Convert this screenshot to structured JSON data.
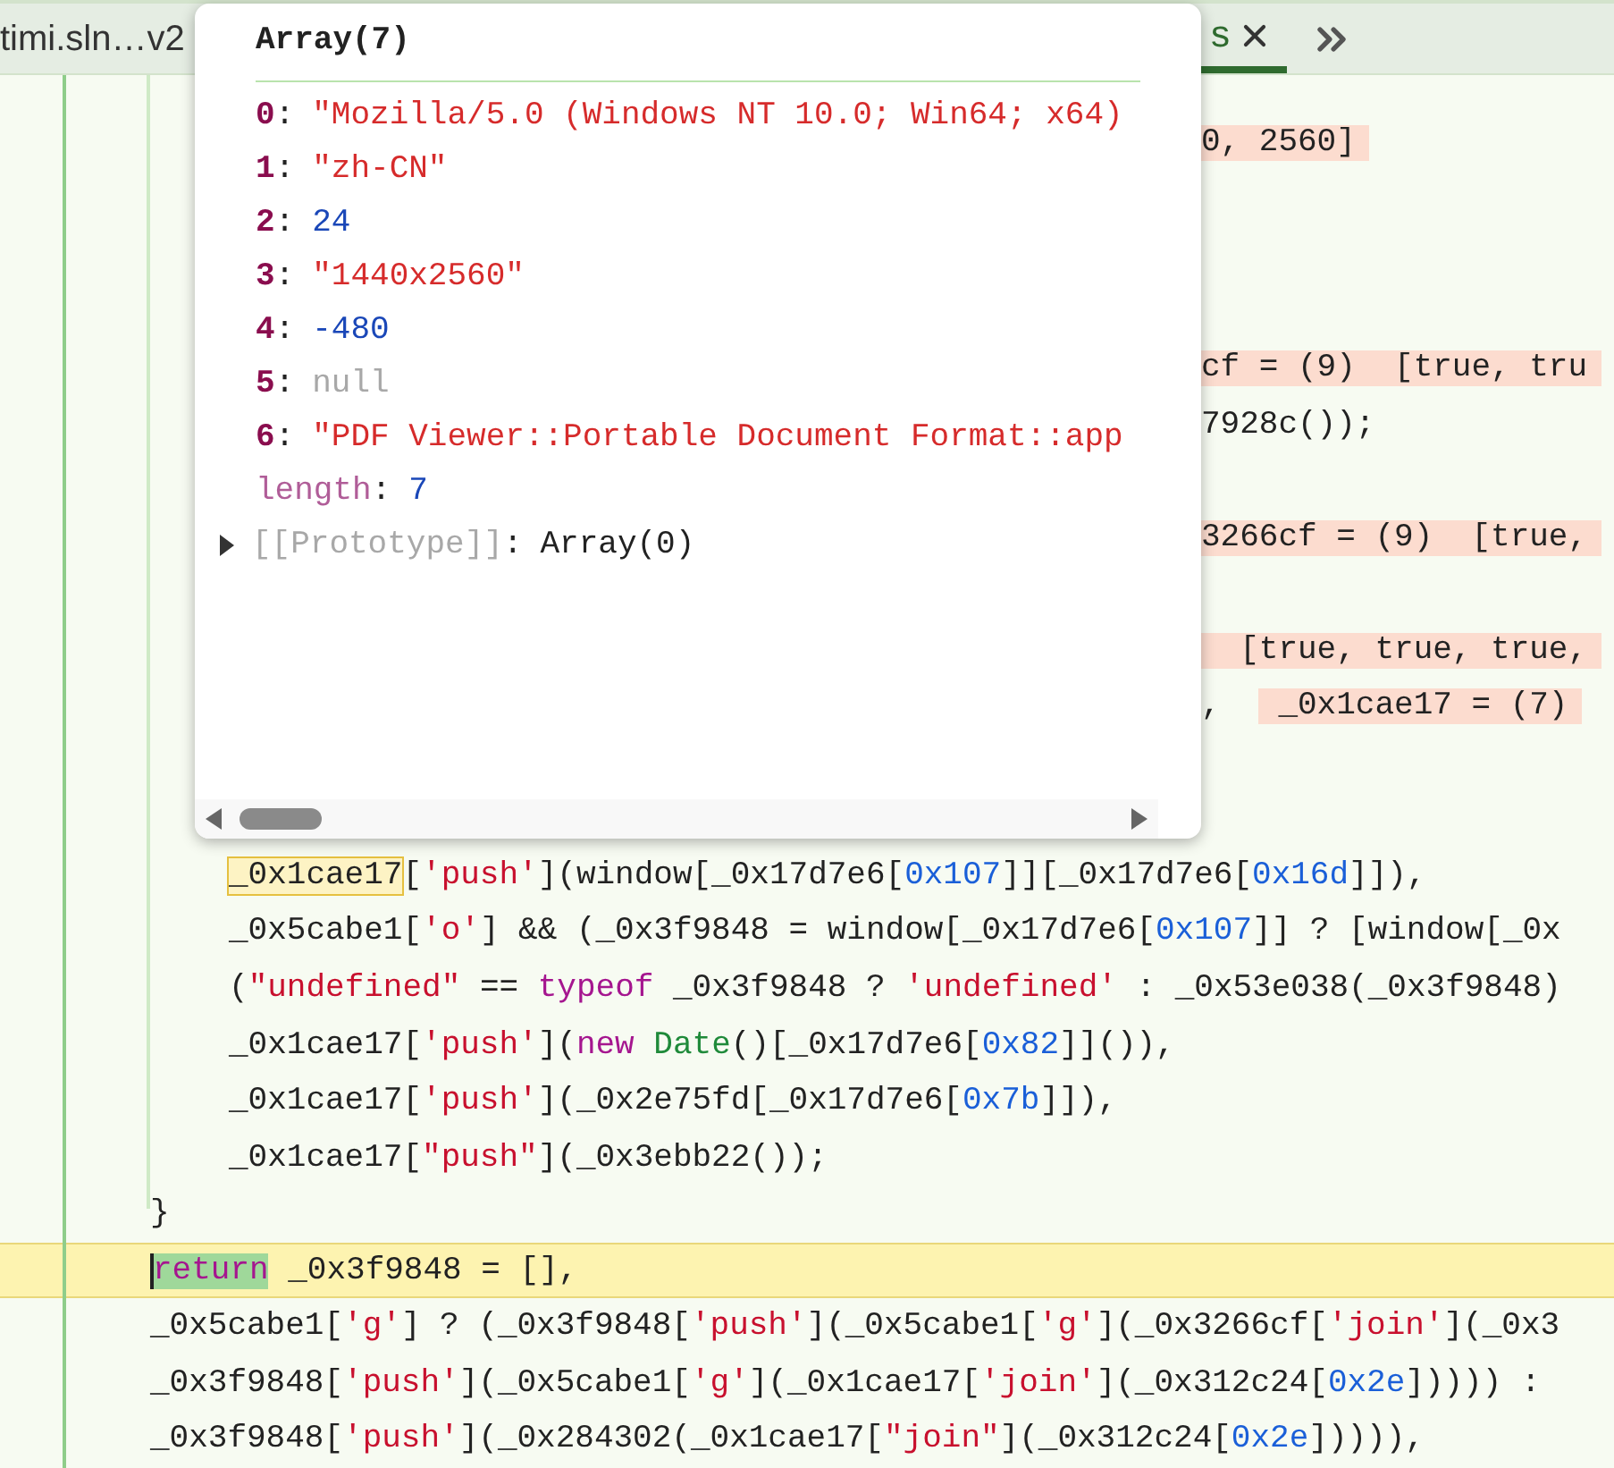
{
  "tabs": [
    {
      "label": "timi.sln…v2",
      "selected": false,
      "closable": false
    },
    {
      "label": "s",
      "selected": true,
      "closable": true
    }
  ],
  "popup": {
    "title": "Array(7)",
    "entries": [
      {
        "kind": "index",
        "key": "0",
        "separator": ":",
        "value": {
          "kind": "string",
          "text": "\"Mozilla/5.0 (Windows NT 10.0; Win64; x64)"
        }
      },
      {
        "kind": "index",
        "key": "1",
        "separator": ":",
        "value": {
          "kind": "string",
          "text": "\"zh-CN\""
        }
      },
      {
        "kind": "index",
        "key": "2",
        "separator": ":",
        "value": {
          "kind": "number",
          "text": "24"
        }
      },
      {
        "kind": "index",
        "key": "3",
        "separator": ":",
        "value": {
          "kind": "string",
          "text": "\"1440x2560\""
        }
      },
      {
        "kind": "index",
        "key": "4",
        "separator": ":",
        "value": {
          "kind": "number",
          "text": "-480"
        }
      },
      {
        "kind": "index",
        "key": "5",
        "separator": ":",
        "value": {
          "kind": "null",
          "text": "null"
        }
      },
      {
        "kind": "index",
        "key": "6",
        "separator": ":",
        "value": {
          "kind": "string",
          "text": "\"PDF Viewer::Portable Document Format::app"
        }
      },
      {
        "kind": "property",
        "key": "length",
        "separator": ":",
        "value": {
          "kind": "number",
          "text": "7"
        }
      },
      {
        "kind": "internal",
        "key": "[[Prototype]]",
        "separator": ":",
        "value": {
          "kind": "plain",
          "text": "Array(0)"
        },
        "expanded": false
      }
    ]
  },
  "editor": {
    "lines": [
      {
        "kind": "fragment",
        "segments": [
          {
            "text": "0, 2560]",
            "highlight": true
          }
        ]
      },
      {
        "kind": "blank"
      },
      {
        "kind": "blank"
      },
      {
        "kind": "blank"
      },
      {
        "kind": "fragment",
        "segments": [
          {
            "text": "cf = (9)  [true, tru",
            "highlight": true
          }
        ]
      },
      {
        "kind": "fragment",
        "segments": [
          {
            "text": "7928c());",
            "highlight": false
          }
        ]
      },
      {
        "kind": "blank"
      },
      {
        "kind": "fragment",
        "segments": [
          {
            "text": "3266cf = (9)  [true,",
            "highlight": true
          }
        ]
      },
      {
        "kind": "blank"
      },
      {
        "kind": "fragment",
        "segments": [
          {
            "text": "  [true, true, true,",
            "highlight": true
          }
        ]
      },
      {
        "kind": "fragment",
        "segments": [
          {
            "text": ",  ",
            "highlight": false
          },
          {
            "text": " _0x1cae17 = (7)",
            "highlight": true
          }
        ]
      },
      {
        "kind": "blank"
      },
      {
        "kind": "blank"
      },
      {
        "kind": "block",
        "children": [
          {
            "kind": "code",
            "current": false,
            "tokens": [
              {
                "kind": "match",
                "text": "_0x1cae17"
              },
              {
                "kind": "plain",
                "text": "["
              },
              {
                "kind": "string",
                "text": "'push'"
              },
              {
                "kind": "plain",
                "text": "](window[_0x17d7e6["
              },
              {
                "kind": "number",
                "text": "0x107"
              },
              {
                "kind": "plain",
                "text": "]][_0x17d7e6["
              },
              {
                "kind": "number",
                "text": "0x16d"
              },
              {
                "kind": "plain",
                "text": "]]),"
              }
            ]
          },
          {
            "kind": "code",
            "current": false,
            "tokens": [
              {
                "kind": "plain",
                "text": "_0x5cabe1["
              },
              {
                "kind": "string",
                "text": "'o'"
              },
              {
                "kind": "plain",
                "text": "] && (_0x3f9848 = window[_0x17d7e6["
              },
              {
                "kind": "number",
                "text": "0x107"
              },
              {
                "kind": "plain",
                "text": "]] ? [window[_0x"
              }
            ]
          },
          {
            "kind": "code",
            "current": false,
            "tokens": [
              {
                "kind": "plain",
                "text": "("
              },
              {
                "kind": "string",
                "text": "\"undefined\""
              },
              {
                "kind": "plain",
                "text": " == "
              },
              {
                "kind": "keyword",
                "text": "typeof"
              },
              {
                "kind": "plain",
                "text": " _0x3f9848 ? "
              },
              {
                "kind": "string",
                "text": "'undefined'"
              },
              {
                "kind": "plain",
                "text": " : _0x53e038(_0x3f9848)"
              }
            ]
          },
          {
            "kind": "code",
            "current": false,
            "tokens": [
              {
                "kind": "plain",
                "text": "_0x1cae17["
              },
              {
                "kind": "string",
                "text": "'push'"
              },
              {
                "kind": "plain",
                "text": "]("
              },
              {
                "kind": "keyword",
                "text": "new "
              },
              {
                "kind": "type",
                "text": "Date"
              },
              {
                "kind": "plain",
                "text": "()[_0x17d7e6["
              },
              {
                "kind": "number",
                "text": "0x82"
              },
              {
                "kind": "plain",
                "text": "]]()),"
              }
            ]
          },
          {
            "kind": "code",
            "current": false,
            "tokens": [
              {
                "kind": "plain",
                "text": "_0x1cae17["
              },
              {
                "kind": "string",
                "text": "'push'"
              },
              {
                "kind": "plain",
                "text": "](_0x2e75fd[_0x17d7e6["
              },
              {
                "kind": "number",
                "text": "0x7b"
              },
              {
                "kind": "plain",
                "text": "]]),"
              }
            ]
          },
          {
            "kind": "code",
            "current": false,
            "tokens": [
              {
                "kind": "plain",
                "text": "_0x1cae17["
              },
              {
                "kind": "string",
                "text": "\"push\""
              },
              {
                "kind": "plain",
                "text": "](_0x3ebb22());"
              }
            ]
          }
        ]
      },
      {
        "kind": "code",
        "current": false,
        "tokens": [
          {
            "kind": "plain",
            "text": "}"
          }
        ]
      },
      {
        "kind": "code",
        "current": true,
        "tokens": [
          {
            "kind": "paused",
            "text": "return"
          },
          {
            "kind": "plain",
            "text": " _0x3f9848 = [],"
          }
        ]
      },
      {
        "kind": "code",
        "current": false,
        "tokens": [
          {
            "kind": "plain",
            "text": "_0x5cabe1["
          },
          {
            "kind": "string",
            "text": "'g'"
          },
          {
            "kind": "plain",
            "text": "] ? (_0x3f9848["
          },
          {
            "kind": "string",
            "text": "'push'"
          },
          {
            "kind": "plain",
            "text": "](_0x5cabe1["
          },
          {
            "kind": "string",
            "text": "'g'"
          },
          {
            "kind": "plain",
            "text": "](_0x3266cf["
          },
          {
            "kind": "string",
            "text": "'join'"
          },
          {
            "kind": "plain",
            "text": "](_0x3"
          }
        ]
      },
      {
        "kind": "code",
        "current": false,
        "tokens": [
          {
            "kind": "plain",
            "text": "_0x3f9848["
          },
          {
            "kind": "string",
            "text": "'push'"
          },
          {
            "kind": "plain",
            "text": "](_0x5cabe1["
          },
          {
            "kind": "string",
            "text": "'g'"
          },
          {
            "kind": "plain",
            "text": "](_0x1cae17["
          },
          {
            "kind": "string",
            "text": "'join'"
          },
          {
            "kind": "plain",
            "text": "](_0x312c24["
          },
          {
            "kind": "number",
            "text": "0x2e"
          },
          {
            "kind": "plain",
            "text": "])))) :"
          }
        ]
      },
      {
        "kind": "code",
        "current": false,
        "tokens": [
          {
            "kind": "plain",
            "text": "_0x3f9848["
          },
          {
            "kind": "string",
            "text": "'push'"
          },
          {
            "kind": "plain",
            "text": "](_0x284302(_0x1cae17["
          },
          {
            "kind": "string",
            "text": "\"join\""
          },
          {
            "kind": "plain",
            "text": "](_0x312c24["
          },
          {
            "kind": "number",
            "text": "0x2e"
          },
          {
            "kind": "plain",
            "text": "])))),"
          }
        ]
      }
    ]
  }
}
